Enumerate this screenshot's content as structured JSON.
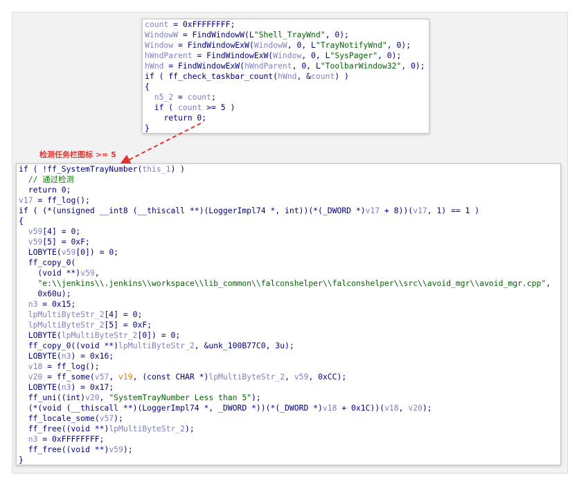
{
  "top_panel": {
    "lines": [
      [
        {
          "t": "v",
          "x": "count"
        },
        {
          "t": "p",
          "x": " = 0xFFFFFFFF;"
        }
      ],
      [
        {
          "t": "v",
          "x": "WindowW"
        },
        {
          "t": "p",
          "x": " = FindWindowW(L"
        },
        {
          "t": "s",
          "x": "\"Shell_TrayWnd\""
        },
        {
          "t": "p",
          "x": ", 0);"
        }
      ],
      [
        {
          "t": "v",
          "x": "Window"
        },
        {
          "t": "p",
          "x": " = FindWindowExW("
        },
        {
          "t": "v",
          "x": "WindowW"
        },
        {
          "t": "p",
          "x": ", 0, L"
        },
        {
          "t": "s",
          "x": "\"TrayNotifyWnd\""
        },
        {
          "t": "p",
          "x": ", 0);"
        }
      ],
      [
        {
          "t": "v",
          "x": "hWndParent"
        },
        {
          "t": "p",
          "x": " = FindWindowExW("
        },
        {
          "t": "v",
          "x": "Window"
        },
        {
          "t": "p",
          "x": ", 0, L"
        },
        {
          "t": "s",
          "x": "\"SysPager\""
        },
        {
          "t": "p",
          "x": ", 0);"
        }
      ],
      [
        {
          "t": "v",
          "x": "hWnd"
        },
        {
          "t": "p",
          "x": " = FindWindowExW("
        },
        {
          "t": "v",
          "x": "hWndParent"
        },
        {
          "t": "p",
          "x": ", 0, L"
        },
        {
          "t": "s",
          "x": "\"ToolbarWindow32\""
        },
        {
          "t": "p",
          "x": ", 0);"
        }
      ],
      [
        {
          "t": "p",
          "x": "if ( ff_check_taskbar_count("
        },
        {
          "t": "v",
          "x": "hWnd"
        },
        {
          "t": "p",
          "x": ", &"
        },
        {
          "t": "v",
          "x": "count"
        },
        {
          "t": "p",
          "x": ") )"
        }
      ],
      [
        {
          "t": "p",
          "x": "{"
        }
      ],
      [
        {
          "t": "p",
          "x": "  "
        },
        {
          "t": "v",
          "x": "n5_2"
        },
        {
          "t": "p",
          "x": " = "
        },
        {
          "t": "v",
          "x": "count"
        },
        {
          "t": "p",
          "x": ";"
        }
      ],
      [
        {
          "t": "p",
          "x": "  if ( "
        },
        {
          "t": "v",
          "x": "count"
        },
        {
          "t": "p",
          "x": " >= 5 )"
        }
      ],
      [
        {
          "t": "p",
          "x": "    return 0;"
        }
      ],
      [
        {
          "t": "p",
          "x": "}"
        }
      ]
    ]
  },
  "annotation": {
    "text": "检测任务栏图标 >= 5",
    "color": "#e8322d"
  },
  "bottom_panel": {
    "lines": [
      [
        {
          "t": "p",
          "x": "if ( !ff_SystemTrayNumber("
        },
        {
          "t": "v",
          "x": "this_1"
        },
        {
          "t": "p",
          "x": ") )"
        }
      ],
      [
        {
          "t": "p",
          "x": "  "
        },
        {
          "t": "c",
          "x": "// 通过检测"
        }
      ],
      [
        {
          "t": "p",
          "x": "  return 0;"
        }
      ],
      [
        {
          "t": "v",
          "x": "v17"
        },
        {
          "t": "p",
          "x": " = ff_log();"
        }
      ],
      [
        {
          "t": "p",
          "x": "if ( (*(unsigned __int8 (__thiscall **)(LoggerImpl74 *, int))(*(_DWORD *)"
        },
        {
          "t": "v",
          "x": "v17"
        },
        {
          "t": "p",
          "x": " + 8))("
        },
        {
          "t": "v",
          "x": "v17"
        },
        {
          "t": "p",
          "x": ", 1) == 1 )"
        }
      ],
      [
        {
          "t": "p",
          "x": "{"
        }
      ],
      [
        {
          "t": "p",
          "x": "  "
        },
        {
          "t": "v",
          "x": "v59"
        },
        {
          "t": "p",
          "x": "[4] = 0;"
        }
      ],
      [
        {
          "t": "p",
          "x": "  "
        },
        {
          "t": "v",
          "x": "v59"
        },
        {
          "t": "p",
          "x": "[5] = 0xF;"
        }
      ],
      [
        {
          "t": "p",
          "x": "  LOBYTE("
        },
        {
          "t": "v",
          "x": "v59"
        },
        {
          "t": "p",
          "x": "[0]) = 0;"
        }
      ],
      [
        {
          "t": "p",
          "x": "  ff_copy_0("
        }
      ],
      [
        {
          "t": "p",
          "x": "    (void **)"
        },
        {
          "t": "v",
          "x": "v59"
        },
        {
          "t": "p",
          "x": ","
        }
      ],
      [
        {
          "t": "p",
          "x": "    "
        },
        {
          "t": "s",
          "x": "\"e:\\\\jenkins\\\\.jenkins\\\\workspace\\\\lib_common\\\\falconshelper\\\\falconshelper\\\\src\\\\avoid_mgr\\\\avoid_mgr.cpp\""
        },
        {
          "t": "p",
          "x": ","
        }
      ],
      [
        {
          "t": "p",
          "x": "    0x60u);"
        }
      ],
      [
        {
          "t": "p",
          "x": "  "
        },
        {
          "t": "v",
          "x": "n3"
        },
        {
          "t": "p",
          "x": " = 0x15;"
        }
      ],
      [
        {
          "t": "p",
          "x": "  "
        },
        {
          "t": "v",
          "x": "lpMultiByteStr_2"
        },
        {
          "t": "p",
          "x": "[4] = 0;"
        }
      ],
      [
        {
          "t": "p",
          "x": "  "
        },
        {
          "t": "v",
          "x": "lpMultiByteStr_2"
        },
        {
          "t": "p",
          "x": "[5] = 0xF;"
        }
      ],
      [
        {
          "t": "p",
          "x": "  LOBYTE("
        },
        {
          "t": "v",
          "x": "lpMultiByteStr_2"
        },
        {
          "t": "p",
          "x": "[0]) = 0;"
        }
      ],
      [
        {
          "t": "p",
          "x": "  ff_copy_0((void **)"
        },
        {
          "t": "v",
          "x": "lpMultiByteStr_2"
        },
        {
          "t": "p",
          "x": ", &unk_100B77C0, 3u);"
        }
      ],
      [
        {
          "t": "p",
          "x": "  LOBYTE("
        },
        {
          "t": "v",
          "x": "n3"
        },
        {
          "t": "p",
          "x": ") = 0x16;"
        }
      ],
      [
        {
          "t": "p",
          "x": "  "
        },
        {
          "t": "v",
          "x": "v18"
        },
        {
          "t": "p",
          "x": " = ff_log();"
        }
      ],
      [
        {
          "t": "p",
          "x": "  "
        },
        {
          "t": "v",
          "x": "v20"
        },
        {
          "t": "p",
          "x": " = ff_some("
        },
        {
          "t": "v",
          "x": "v57"
        },
        {
          "t": "p",
          "x": ", "
        },
        {
          "t": "m",
          "x": "v19"
        },
        {
          "t": "p",
          "x": ", (const CHAR *)"
        },
        {
          "t": "v",
          "x": "lpMultiByteStr_2"
        },
        {
          "t": "p",
          "x": ", "
        },
        {
          "t": "v",
          "x": "v59"
        },
        {
          "t": "p",
          "x": ", 0xCC);"
        }
      ],
      [
        {
          "t": "p",
          "x": "  LOBYTE("
        },
        {
          "t": "v",
          "x": "n3"
        },
        {
          "t": "p",
          "x": ") = 0x17;"
        }
      ],
      [
        {
          "t": "p",
          "x": "  ff_uni((int)"
        },
        {
          "t": "v",
          "x": "v20"
        },
        {
          "t": "p",
          "x": ", "
        },
        {
          "t": "s",
          "x": "\"SystemTrayNumber Less than 5\""
        },
        {
          "t": "p",
          "x": ");"
        }
      ],
      [
        {
          "t": "p",
          "x": "  (*(void (__thiscall **)(LoggerImpl74 *, _DWORD *))(*(_DWORD *)"
        },
        {
          "t": "v",
          "x": "v18"
        },
        {
          "t": "p",
          "x": " + 0x1C))("
        },
        {
          "t": "v",
          "x": "v18"
        },
        {
          "t": "p",
          "x": ", "
        },
        {
          "t": "v",
          "x": "v20"
        },
        {
          "t": "p",
          "x": ");"
        }
      ],
      [
        {
          "t": "p",
          "x": "  ff_locale_some("
        },
        {
          "t": "v",
          "x": "v57"
        },
        {
          "t": "p",
          "x": ");"
        }
      ],
      [
        {
          "t": "p",
          "x": "  ff_free((void **)"
        },
        {
          "t": "v",
          "x": "lpMultiByteStr_2"
        },
        {
          "t": "p",
          "x": ");"
        }
      ],
      [
        {
          "t": "p",
          "x": "  "
        },
        {
          "t": "v",
          "x": "n3"
        },
        {
          "t": "p",
          "x": " = 0xFFFFFFFF;"
        }
      ],
      [
        {
          "t": "p",
          "x": "  ff_free((void **)"
        },
        {
          "t": "v",
          "x": "v59"
        },
        {
          "t": "p",
          "x": ");"
        }
      ],
      [
        {
          "t": "p",
          "x": "}"
        }
      ]
    ]
  }
}
